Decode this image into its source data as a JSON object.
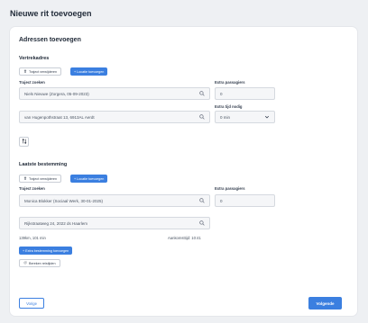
{
  "page": {
    "title": "Nieuwe rit toevoegen"
  },
  "card": {
    "title": "Adressen toevoegen"
  },
  "departure": {
    "section_title": "Vertrekadres",
    "delete_trip_label": "Traject verwijderen",
    "add_location_label": "+ Locatie toevoegen",
    "trip_search_label": "Traject zoeken",
    "trip_search_value": "Niels Nieuwe (Zorgera, 05-09-2023)",
    "extra_passengers_label": "Extra passagiers",
    "extra_passengers_value": "0",
    "address_value": "van Hugenpothstraat 13, 6913AL Aerdt",
    "extra_time_label": "Extra tijd nodig",
    "extra_time_value": "0 min"
  },
  "swap": {
    "icon": "swap-vertical-icon"
  },
  "destination": {
    "section_title": "Laatste bestemming",
    "delete_trip_label": "Traject verwijderen",
    "add_location_label": "+ Locatie toevoegen",
    "trip_search_label": "Traject zoeken",
    "trip_search_value": "Monica Blokker (Sociaal Werk, 30-01-2025)",
    "extra_passengers_label": "Extra passagiers",
    "extra_passengers_value": "0",
    "address_value": "Rijkstraatweg 24, 2022 ds Haarlem"
  },
  "route": {
    "distance_time": "139km, 101 min",
    "arrival": "Aankomsttijd: 10:41",
    "add_extra_destination_label": "+ Extra bestemming toevoegen",
    "recalculate_label": "Bereken reistijden"
  },
  "footer": {
    "back_label": "Vorige",
    "next_label": "Volgende"
  },
  "colors": {
    "primary": "#3b7fe0",
    "background": "#eef0f3",
    "card": "#ffffff"
  }
}
